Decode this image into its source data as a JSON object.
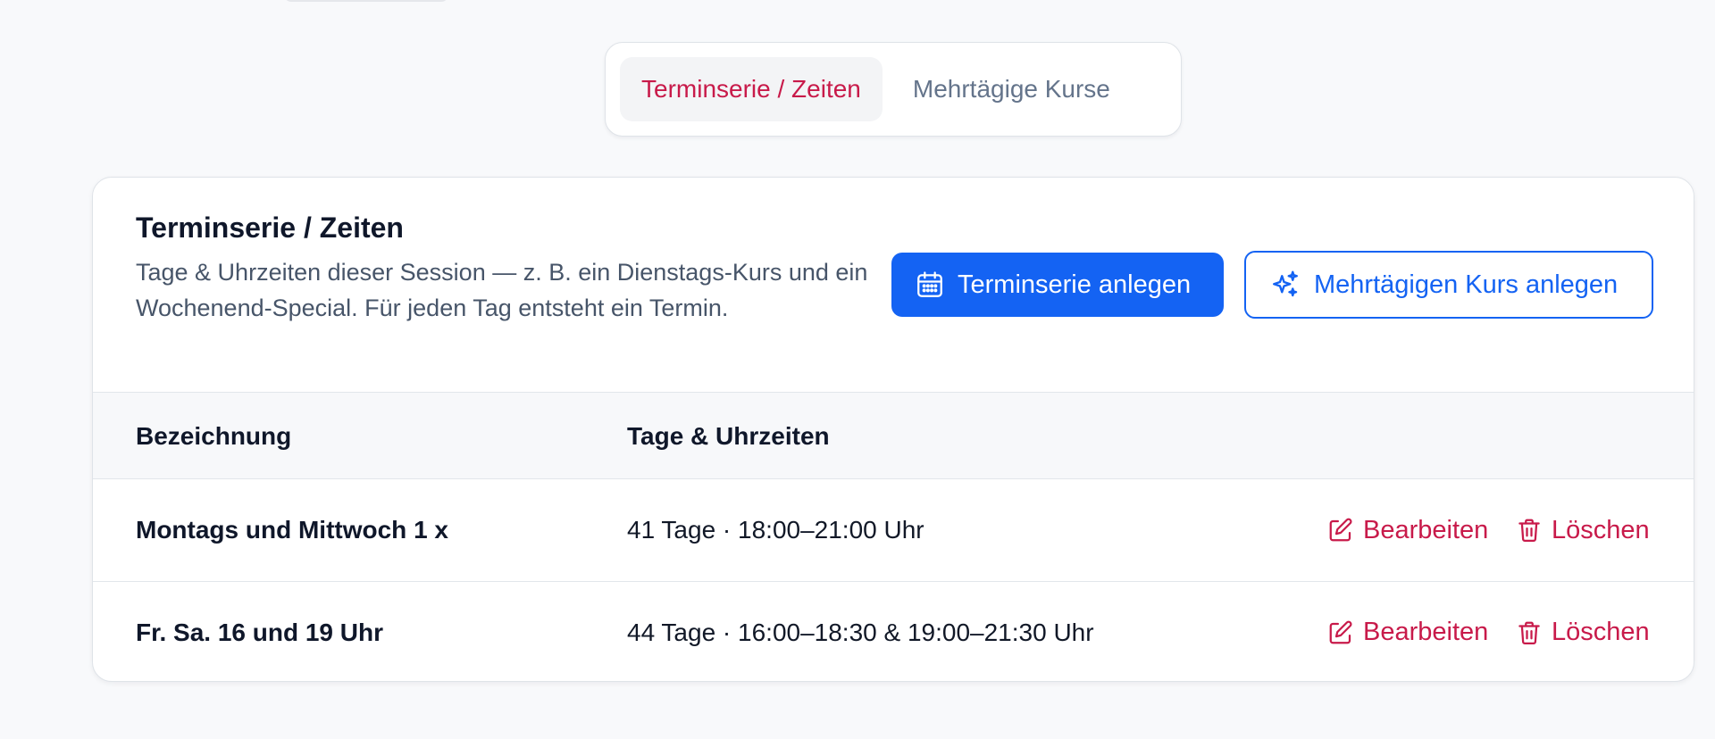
{
  "tabs": [
    {
      "label": "Terminserie / Zeiten",
      "active": true
    },
    {
      "label": "Mehrtägige Kurse",
      "active": false
    }
  ],
  "card": {
    "title": "Terminserie / Zeiten",
    "description": "Tage & Uhrzeiten dieser Session — z. B. ein Dienstags-Kurs und ein Wochenend-Special. Für jeden Tag entsteht ein Termin.",
    "primary_button": {
      "label": "Terminserie anlegen",
      "icon": "calendar-icon"
    },
    "secondary_button": {
      "label": "Mehrtägigen Kurs anlegen",
      "icon": "sparkles-icon"
    }
  },
  "table": {
    "columns": [
      "Bezeichnung",
      "Tage & Uhrzeiten"
    ],
    "rows": [
      {
        "name": "Montags und Mittwoch 1 x",
        "times": "41 Tage · 18:00–21:00 Uhr",
        "edit": "Bearbeiten",
        "delete": "Löschen"
      },
      {
        "name": "Fr. Sa. 16 und 19 Uhr",
        "times": "44 Tage · 16:00–18:30 & 19:00–21:30 Uhr",
        "edit": "Bearbeiten",
        "delete": "Löschen"
      }
    ]
  },
  "colors": {
    "accent_red": "#c81a4a",
    "primary_blue": "#1463f3",
    "page_background": "#f8f9fb"
  }
}
